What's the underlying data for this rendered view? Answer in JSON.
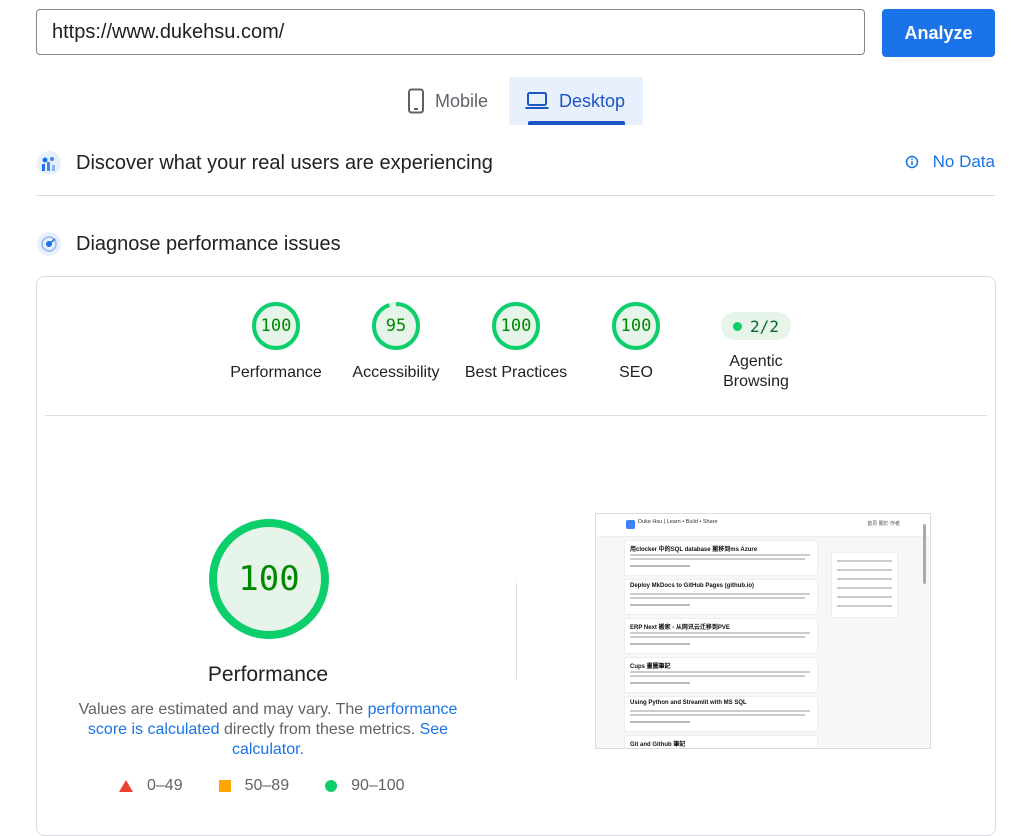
{
  "url_bar": {
    "value": "https://www.dukehsu.com/",
    "analyze_label": "Analyze"
  },
  "tabs": [
    {
      "label": "Mobile",
      "icon": "smartphone-icon",
      "selected": false
    },
    {
      "label": "Desktop",
      "icon": "laptop-icon",
      "selected": true
    }
  ],
  "field_data": {
    "title": "Discover what your real users are experiencing",
    "status": "No Data",
    "icon": "people-icon"
  },
  "diagnose": {
    "title": "Diagnose performance issues",
    "icon": "radar-icon"
  },
  "categories": [
    {
      "label": "Performance",
      "score": "100",
      "fraction": 1.0
    },
    {
      "label": "Accessibility",
      "score": "95",
      "fraction": 0.95
    },
    {
      "label": "Best Practices",
      "score": "100",
      "fraction": 1.0
    },
    {
      "label": "SEO",
      "score": "100",
      "fraction": 1.0
    },
    {
      "label": "Agentic Browsing",
      "score": "2/2",
      "fraction": 1.0
    }
  ],
  "performance": {
    "score": "100",
    "fraction": 1.0,
    "label": "Performance",
    "desc_prefix": "Values are estimated and may vary. The ",
    "desc_link1": "performance score is calculated",
    "desc_middle": " directly from these metrics. ",
    "desc_link2": "See calculator."
  },
  "legend": [
    {
      "range": "0–49",
      "shape": "triangle",
      "color": "#ea4335"
    },
    {
      "range": "50–89",
      "shape": "square",
      "color": "#ffa400"
    },
    {
      "range": "90–100",
      "shape": "circle",
      "color": "#0cce6b"
    }
  ],
  "screenshot": {
    "brand": "Duke Hsu | Learn • Build • Share",
    "nav": "首頁 關於 作者",
    "cards": [
      "用clocker 中的SQL database 搬移到ms Azure",
      "Deploy MkDocs to GitHub Pages (github.io)",
      "ERP Next 搬家 - 从网讯云迁移到PVE",
      "Cups 畫圖筆記",
      "Using Python and Streamlit with MS SQL",
      "Git and Github 筆記"
    ]
  },
  "colors": {
    "accent": "#1a73e8",
    "pass": "#0cce6b",
    "pass_text": "#008800",
    "pass_bg": "#e6f4ea"
  }
}
